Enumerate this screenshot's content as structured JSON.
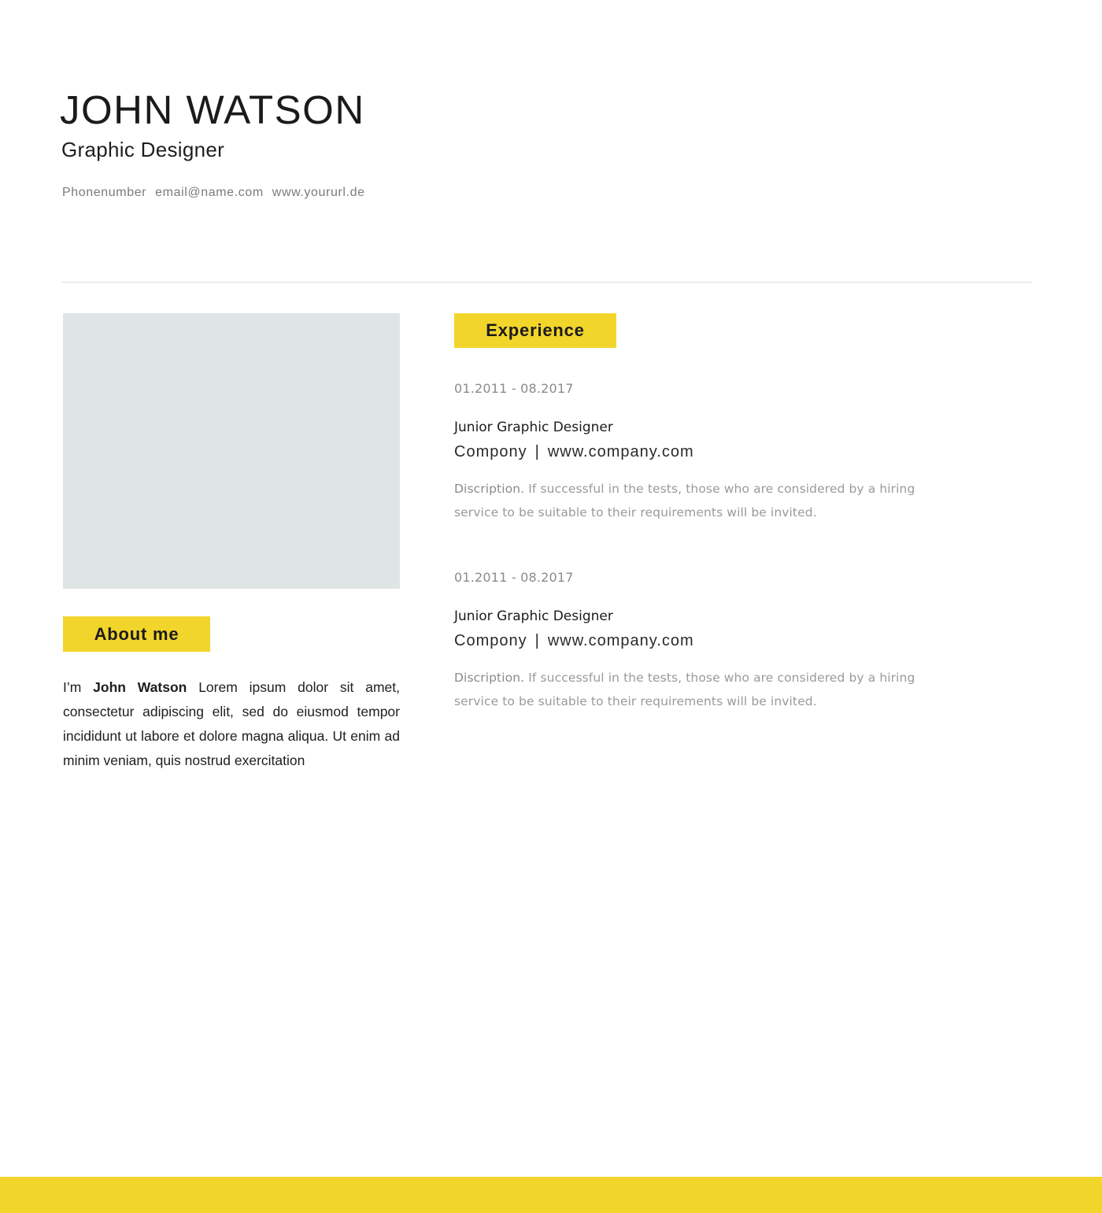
{
  "header": {
    "name": "JOHN WATSON",
    "role": "Graphic Designer",
    "contacts": {
      "phone": "Phonenumber",
      "email": "email@name.com",
      "url": "www.yoururl.de"
    }
  },
  "about": {
    "heading": "About me",
    "intro": "I’m",
    "name_bold": "John Watson",
    "body": "Lorem ipsum dolor sit amet, consectetur adipiscing elit, sed do eiusmod tempor incididunt ut labore et dolore magna aliqua. Ut enim ad minim veniam, quis nostrud exercitation"
  },
  "experience": {
    "heading": "Experience",
    "jobs": [
      {
        "period": "01.2011 - 08.2017",
        "title": "Junior Graphic Designer",
        "company": "Compony",
        "separator": "|",
        "company_url": "www.company.com",
        "desc_label": "Discription.",
        "desc_text": "If successful in the tests, those who are considered by a hiring service to be suitable to their requirements will be invited."
      },
      {
        "period": "01.2011 - 08.2017",
        "title": "Junior Graphic Designer",
        "company": "Compony",
        "separator": "|",
        "company_url": "www.company.com",
        "desc_label": "Discription.",
        "desc_text": "If successful in the tests, those who are considered by a hiring service to be suitable to their requirements will be invited."
      }
    ]
  },
  "colors": {
    "accent": "#f2d52b",
    "photo_placeholder": "#dfe5e5",
    "text_dark": "#1b1b1b",
    "text_muted": "#9a9a9a"
  }
}
